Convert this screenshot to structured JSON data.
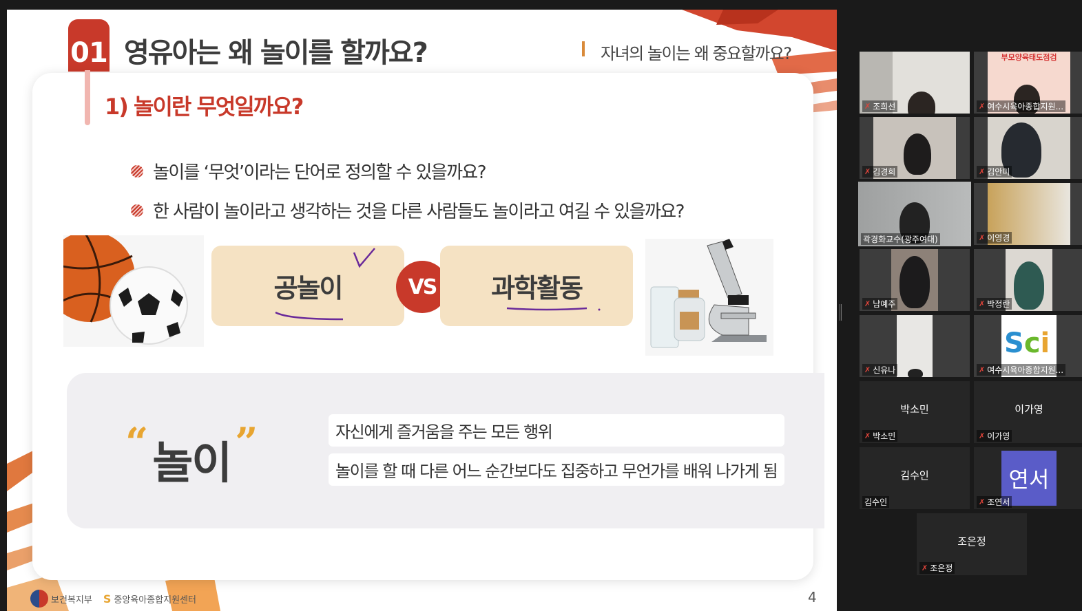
{
  "slide": {
    "number": "01",
    "title": "영유아는 왜 놀이를 할까요?",
    "subtitle": "자녀의 놀이는 왜 중요할까요?",
    "section_title": "1) 놀이란 무엇일까요?",
    "questions": [
      "놀이를 ‘무엇’이라는 단어로 정의할 수 있을까요?",
      "한 사람이 놀이라고 생각하는 것을 다른 사람들도 놀이라고 여길 수 있을까요?"
    ],
    "compare_left": "공놀이",
    "compare_vs": "VS",
    "compare_right": "과학활동",
    "definition_term": "놀이",
    "quote_open": "“",
    "quote_close": "”",
    "definitions": [
      "자신에게 즐거움을 주는 모든 행위",
      "놀이를 할 때 다른 어느 순간보다도 집중하고 무언가를 배워 나가게 됨"
    ],
    "page_number": "4",
    "footer_logo_1": "보건복지부",
    "footer_logo_2": "중앙육아종합지원센터",
    "accent_color": "#c8392a"
  },
  "gallery": {
    "participants": [
      {
        "name": "조희선",
        "muted": true,
        "video": true
      },
      {
        "name": "여수시육아종합지원...",
        "muted": true,
        "video": true,
        "banner": "부모양육태도점검"
      },
      {
        "name": "김경희",
        "muted": true,
        "video": true
      },
      {
        "name": "김안미",
        "muted": true,
        "video": true
      },
      {
        "name": "곽경화교수(광주여대)",
        "muted": false,
        "video": true,
        "active": true
      },
      {
        "name": "이영경",
        "muted": true,
        "video": true
      },
      {
        "name": "남예주",
        "muted": true,
        "video": true
      },
      {
        "name": "박정란",
        "muted": true,
        "video": true
      },
      {
        "name": "신유나",
        "muted": true,
        "video": true
      },
      {
        "name": "여수시육아종합지원...",
        "muted": true,
        "video": true
      },
      {
        "name": "박소민",
        "muted": true,
        "video": false,
        "center": "박소민"
      },
      {
        "name": "이가영",
        "muted": true,
        "video": false,
        "center": "이가영"
      },
      {
        "name": "김수인",
        "muted": false,
        "video": false,
        "center": "김수인"
      },
      {
        "name": "조연서",
        "muted": true,
        "video": false,
        "avatar": "연서"
      },
      {
        "name": "조은정",
        "muted": true,
        "video": false,
        "center": "조은정"
      }
    ],
    "mic_off_icon": "mic-off-icon",
    "active_speaker_color": "#c9d87a"
  }
}
